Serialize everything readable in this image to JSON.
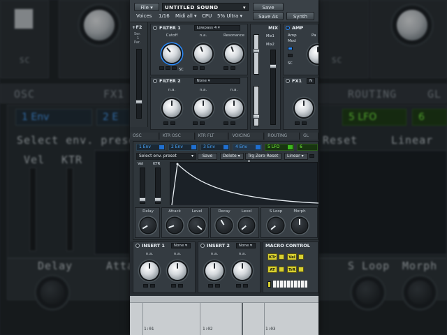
{
  "background": {
    "labels": {
      "osc": "OSC",
      "fx1": "FX1",
      "routing": "ROUTING",
      "gl": "GL",
      "select_preset": "Select env. preset",
      "reset": "Reset",
      "linear": "Linear",
      "vel": "Vel",
      "ktr": "KTR",
      "delay": "Delay",
      "att": "Atta",
      "sloop": "S Loop",
      "morph": "Morph",
      "sc": "SC"
    },
    "tabs": {
      "env1": "1 Env",
      "env2": "2 E",
      "lfo5": "5 LFO",
      "six": "6"
    }
  },
  "topbar": {
    "file": "File",
    "preset_name": "UNTITLED SOUND",
    "save": "Save",
    "save_as": "Save As",
    "voices_label": "Voices",
    "voices_value": "1/16",
    "midi": "Midi all",
    "cpu_label": "CPU",
    "cpu_value": "5% Ultra",
    "synth": "Synth"
  },
  "left_strip": {
    "label": "+F2",
    "sub1": "Ser.",
    "sub2": "1",
    "sub3": "Par."
  },
  "filter1": {
    "title": "FILTER 1",
    "type": "Lowpass 4",
    "knobs": [
      "Cutoff",
      "n.a.",
      "Resonance"
    ],
    "mini_labels": [
      "2",
      "SC"
    ]
  },
  "filter2": {
    "title": "FILTER 2",
    "type": "None",
    "knobs": [
      "n.a.",
      "n.a.",
      "n.a."
    ]
  },
  "mix": {
    "title": "MIX",
    "mix1": "Mix1",
    "mix2": "Mix2"
  },
  "amp": {
    "title": "AMP",
    "amp": "Amp",
    "pa": "Pa",
    "mod": "Mod",
    "sc": "SC"
  },
  "fx1": {
    "title": "FX1",
    "type": "N"
  },
  "tabs": [
    "OSC",
    "KTR OSC",
    "KTR FLT",
    "VOICING",
    "ROUTING",
    "GL"
  ],
  "env": {
    "tabs": [
      {
        "label": "1 Env"
      },
      {
        "label": "2 Env"
      },
      {
        "label": "3 Env"
      },
      {
        "label": "4 Env"
      },
      {
        "label": "5 LFO"
      },
      {
        "label": "6"
      }
    ],
    "preset_select": "Select env. preset",
    "save": "Save",
    "delete": "Delete",
    "trg_zero_reset": "Trg Zero Reset",
    "linear": "Linear",
    "vel": "Vel",
    "ktr": "KTR",
    "knobs": [
      "Delay",
      "Attack",
      "Level",
      "Decay",
      "Level",
      "S Loop",
      "Morph"
    ]
  },
  "insert1": {
    "title": "INSERT 1",
    "type": "None",
    "knobs": [
      "n.a.",
      "n.a."
    ]
  },
  "insert2": {
    "title": "INSERT 2",
    "type": "None",
    "knobs": [
      "n.a.",
      "n.a."
    ]
  },
  "macro": {
    "title": "MACRO CONTROL",
    "buttons": [
      "KTr",
      "Vel",
      "AT",
      "TrR"
    ]
  },
  "timeline": {
    "markers": [
      "1:01",
      "1:02",
      "1:03"
    ]
  },
  "colors": {
    "accent_blue": "#2a8cff",
    "lfo_green": "#7dff42",
    "macro_yellow": "#d8d030"
  }
}
